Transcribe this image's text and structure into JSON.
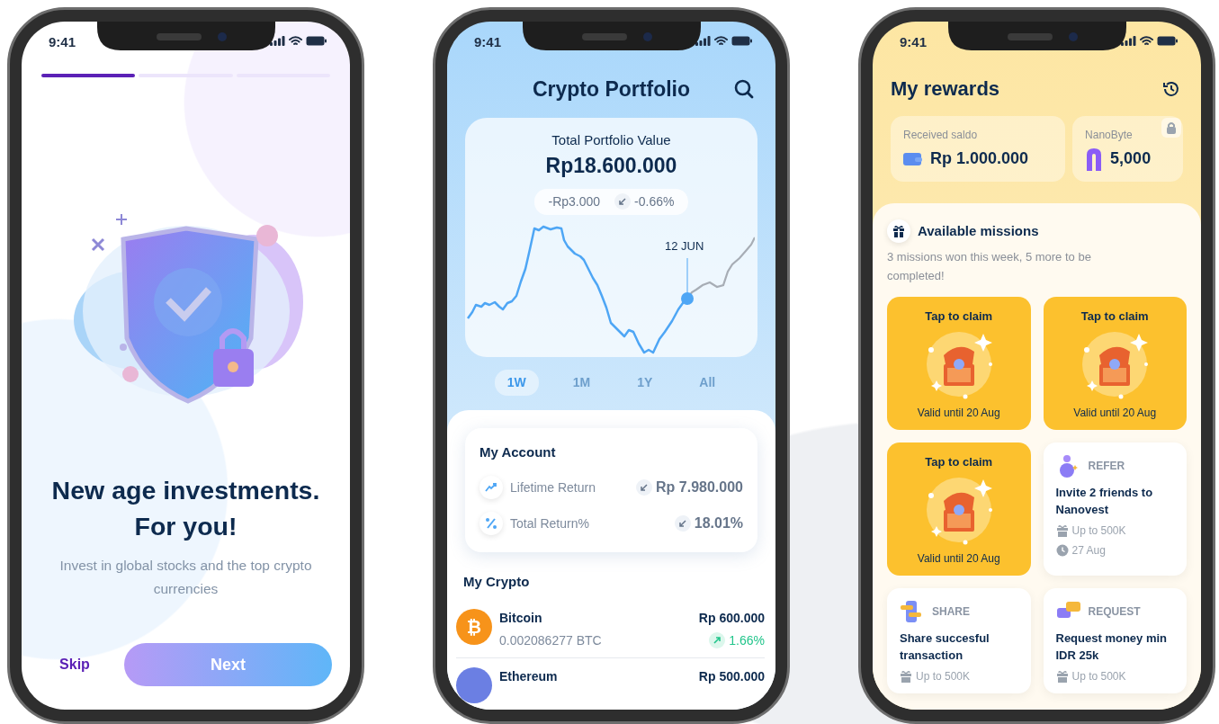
{
  "onboarding": {
    "status_time": "9:41",
    "steps": [
      {
        "selected": true
      },
      {
        "selected": false
      },
      {
        "selected": false
      }
    ],
    "title": "New age investments. For you!",
    "subtitle": "Invest in global stocks and the top crypto currencies",
    "skip": "Skip",
    "next": "Next"
  },
  "portfolio": {
    "status_time": "9:41",
    "title": "Crypto Portfolio",
    "total_label": "Total Portfolio Value",
    "total_value": "Rp18.600.000",
    "change_amount": "-Rp3.000",
    "change_percent": "-0.66%",
    "change_rising": false,
    "chart_marker_label": "12 JUN",
    "periods": [
      {
        "label": "1W",
        "selected": true
      },
      {
        "label": "1M",
        "selected": false
      },
      {
        "label": "1Y",
        "selected": false
      },
      {
        "label": "All",
        "selected": false
      }
    ],
    "account": {
      "title": "My Account",
      "rows": [
        {
          "label": "Lifetime Return",
          "value": "Rp 7.980.000",
          "rising": false
        },
        {
          "label": "Total Return%",
          "value": "18.01%",
          "rising": false
        }
      ]
    },
    "crypto_title": "My Crypto",
    "crypto": [
      {
        "name": "Bitcoin",
        "symbol": "₿",
        "color": "#f7931a",
        "amount": "0.002086277 BTC",
        "value": "Rp 600.000",
        "change": "1.66%",
        "rising": true
      },
      {
        "name": "Ethereum",
        "color": "#6b7fe3",
        "value": "Rp 500.000"
      }
    ]
  },
  "rewards": {
    "status_time": "9:41",
    "title": "My rewards",
    "balances": [
      {
        "label": "Received saldo",
        "value": "Rp 1.000.000",
        "locked": false
      },
      {
        "label": "NanoByte",
        "value": "5,000",
        "locked": true
      }
    ],
    "missions_title": "Available missions",
    "missions_subtitle": "3 missions won this week, 5 more to be completed!",
    "missions": [
      {
        "kind": "claim",
        "title": "Tap to claim",
        "valid": "Valid until 20 Aug"
      },
      {
        "kind": "claim",
        "title": "Tap to claim",
        "valid": "Valid until 20 Aug"
      },
      {
        "kind": "claim",
        "title": "Tap to claim",
        "valid": "Valid until 20 Aug"
      },
      {
        "kind": "task",
        "category": "REFER",
        "title": "Invite 2 friends to Nanovest",
        "reward": "Up to 500K",
        "date": "27 Aug"
      },
      {
        "kind": "task",
        "category": "SHARE",
        "title": "Share succesful transaction",
        "reward": "Up to 500K"
      },
      {
        "kind": "task",
        "category": "REQUEST",
        "title": "Request money min IDR 25k",
        "reward": "Up to 500K"
      }
    ]
  }
}
